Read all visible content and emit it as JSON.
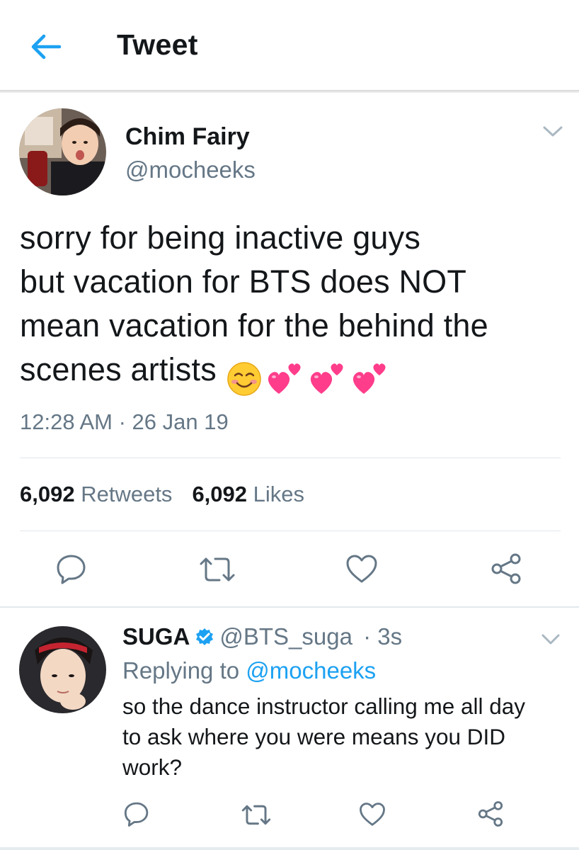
{
  "header": {
    "title": "Tweet",
    "back_icon": "arrow-left-icon",
    "accent": "#1da1f2"
  },
  "tweet": {
    "author_name": "Chim Fairy",
    "author_handle": "@mocheeks",
    "text_lines": [
      "sorry for being inactive guys",
      "but vacation for BTS does NOT",
      "mean vacation for the behind the",
      "scenes artists"
    ],
    "emojis": [
      "smiling-face-icon",
      "two-hearts-icon",
      "two-hearts-icon",
      "two-hearts-icon"
    ],
    "timestamp": "12:28 AM · 26 Jan 19",
    "retweets_count": "6,092",
    "retweets_label": "Retweets",
    "likes_count": "6,092",
    "likes_label": "Likes",
    "actions": [
      "reply-icon",
      "retweet-icon",
      "like-icon",
      "share-icon"
    ]
  },
  "reply": {
    "author_name": "SUGA",
    "verified": true,
    "author_handle": "@BTS_suga",
    "time": "3s",
    "replying_prefix": "Replying to",
    "replying_to": "@mocheeks",
    "text_lines": [
      "so the dance instructor calling me all day",
      "to ask where you were means you DID",
      "work?"
    ],
    "actions": [
      "reply-icon",
      "retweet-icon",
      "like-icon",
      "share-icon"
    ]
  },
  "colors": {
    "text": "#14171a",
    "secondary": "#657786",
    "link": "#1da1f2",
    "divider": "#e1e8ed",
    "heart": "#ff3d8b"
  }
}
